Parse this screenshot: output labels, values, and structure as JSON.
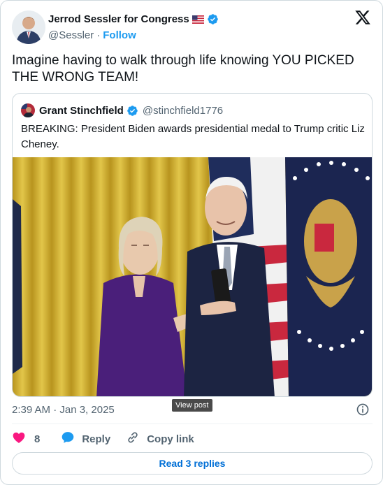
{
  "author": {
    "name": "Jerrod Sessler for Congress",
    "handle": "@Sessler",
    "separator": "·",
    "follow_label": "Follow"
  },
  "tweet": {
    "text": "Imagine having to walk through life knowing YOU PICKED THE WRONG TEAM!"
  },
  "quote": {
    "name": "Grant Stinchfield",
    "handle": "@stinchfield1776",
    "text": "BREAKING: President Biden awards presidential medal to Trump critic Liz Cheney."
  },
  "tooltip": {
    "label": "View post"
  },
  "meta": {
    "timestamp": "2:39 AM · Jan 3, 2025"
  },
  "actions": {
    "like_count": "8",
    "reply_label": "Reply",
    "copy_label": "Copy link"
  },
  "footer": {
    "read_replies_label": "Read 3 replies"
  },
  "colors": {
    "accent": "#1d9bf0",
    "like": "#f91880",
    "text_secondary": "#536471",
    "border": "#cfd9de"
  },
  "icons": [
    "flag-us-icon",
    "verified-badge-icon",
    "x-logo-icon",
    "info-icon",
    "heart-icon",
    "reply-bubble-icon",
    "link-icon"
  ]
}
